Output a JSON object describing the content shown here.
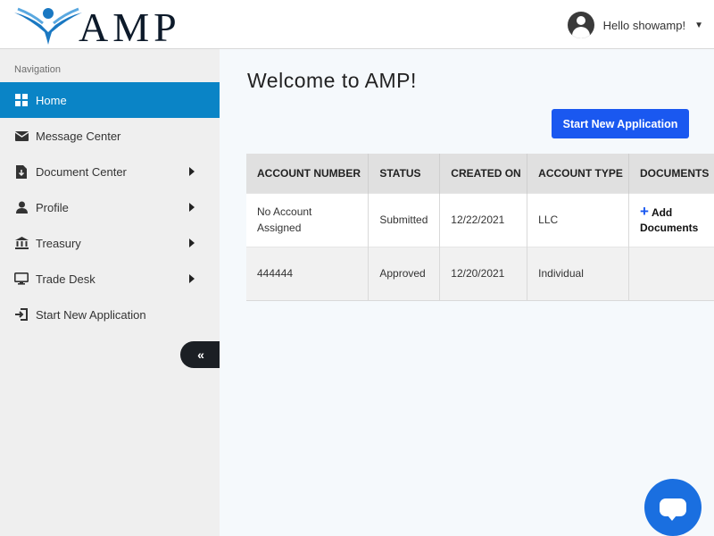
{
  "brand": {
    "name": "AMP",
    "logo_icon": "amp-figure-logo",
    "accent": "#1a78c2"
  },
  "header": {
    "greeting": "Hello showamp!",
    "user_icon": "user-avatar-icon",
    "caret_icon": "caret-down-icon"
  },
  "sidebar": {
    "title": "Navigation",
    "items": [
      {
        "label": "Home",
        "icon": "grid-icon",
        "active": true,
        "has_submenu": false
      },
      {
        "label": "Message Center",
        "icon": "envelope-icon",
        "has_submenu": false
      },
      {
        "label": "Document Center",
        "icon": "file-download-icon",
        "has_submenu": true
      },
      {
        "label": "Profile",
        "icon": "user-icon",
        "has_submenu": true
      },
      {
        "label": "Treasury",
        "icon": "bank-icon",
        "has_submenu": true
      },
      {
        "label": "Trade Desk",
        "icon": "monitor-icon",
        "has_submenu": true
      },
      {
        "label": "Start New Application",
        "icon": "sign-in-icon",
        "has_submenu": false
      }
    ],
    "collapse_label": "«"
  },
  "main": {
    "title": "Welcome to AMP!",
    "start_button": "Start New Application",
    "table": {
      "headers": [
        "ACCOUNT NUMBER",
        "STATUS",
        "CREATED ON",
        "ACCOUNT TYPE",
        "DOCUMENTS"
      ],
      "rows": [
        {
          "account": "No Account Assigned",
          "status": "Submitted",
          "created": "12/22/2021",
          "type": "LLC",
          "documents": "Add Documents"
        },
        {
          "account": "444444",
          "status": "Approved",
          "created": "12/20/2021",
          "type": "Individual",
          "documents": ""
        }
      ]
    }
  },
  "chat": {
    "icon": "chat-bubble-icon"
  },
  "colors": {
    "active_nav": "#0a84c6",
    "primary_button": "#1a58f0",
    "chat_button": "#1a6fe0"
  }
}
